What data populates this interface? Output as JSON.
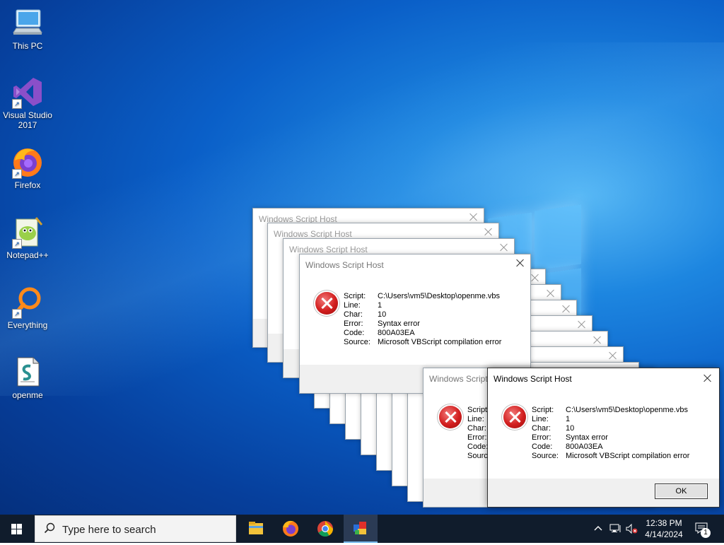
{
  "desktop_icons": [
    {
      "label": "This PC",
      "icon": "this-pc-icon"
    },
    {
      "label": "Visual Studio\n2017",
      "icon": "visual-studio-icon"
    },
    {
      "label": "Firefox",
      "icon": "firefox-icon"
    },
    {
      "label": "Notepad++",
      "icon": "notepadpp-icon"
    },
    {
      "label": "Everything",
      "icon": "everything-icon"
    },
    {
      "label": "openme",
      "icon": "vbs-script-icon"
    }
  ],
  "dialog": {
    "title": "Windows Script Host",
    "fields": [
      {
        "key": "Script:",
        "value": "C:\\Users\\vm5\\Desktop\\openme.vbs"
      },
      {
        "key": "Line:",
        "value": "1"
      },
      {
        "key": "Char:",
        "value": "10"
      },
      {
        "key": "Error:",
        "value": "Syntax error"
      },
      {
        "key": "Code:",
        "value": "800A03EA"
      },
      {
        "key": "Source:",
        "value": "Microsoft VBScript compilation error"
      }
    ],
    "partial_keys": [
      "Script",
      "Line:",
      "Char:",
      "Error:",
      "Code:",
      "Source:"
    ],
    "partial_title": "Windows Script",
    "ok_label": "OK"
  },
  "taskbar": {
    "search_placeholder": "Type here to search",
    "pinned": [
      "file-explorer-icon",
      "firefox-icon",
      "chrome-icon",
      "script-host-icon"
    ],
    "time": "12:38 PM",
    "date": "4/14/2024",
    "notification_count": "1"
  },
  "colors": {
    "desktop": "#0a5fc8",
    "taskbar": "#101c2c",
    "error_red": "#d21e1e"
  }
}
